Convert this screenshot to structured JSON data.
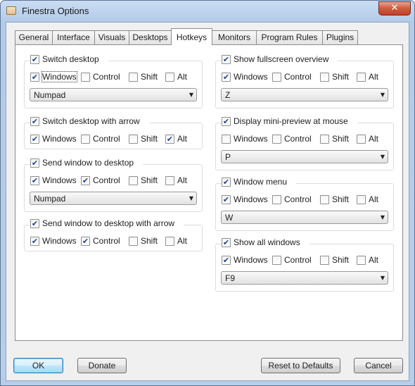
{
  "window": {
    "title": "Finestra Options",
    "close_glyph": "✕"
  },
  "tabs": [
    {
      "label": "General"
    },
    {
      "label": "Interface"
    },
    {
      "label": "Visuals"
    },
    {
      "label": "Desktops"
    },
    {
      "label": "Hotkeys",
      "active": true
    },
    {
      "label": "Monitors"
    },
    {
      "label": "Program Rules"
    },
    {
      "label": "Plugins"
    }
  ],
  "modifier_labels": {
    "windows": "Windows",
    "control": "Control",
    "shift": "Shift",
    "alt": "Alt"
  },
  "check_glyph": "✔",
  "dropdown_arrow": "▼",
  "groups": {
    "switch_desktop": {
      "title": "Switch desktop",
      "enabled": true,
      "windows": true,
      "control": false,
      "shift": false,
      "alt": false,
      "key": "Numpad"
    },
    "switch_desktop_arrow": {
      "title": "Switch desktop with arrow",
      "enabled": true,
      "windows": true,
      "control": false,
      "shift": false,
      "alt": true
    },
    "send_window": {
      "title": "Send window to desktop",
      "enabled": true,
      "windows": true,
      "control": true,
      "shift": false,
      "alt": false,
      "key": "Numpad"
    },
    "send_window_arrow": {
      "title": "Send window to desktop with arrow",
      "enabled": true,
      "windows": true,
      "control": true,
      "shift": false,
      "alt": false
    },
    "fullscreen_overview": {
      "title": "Show fullscreen overview",
      "enabled": true,
      "windows": true,
      "control": false,
      "shift": false,
      "alt": false,
      "key": "Z"
    },
    "mini_preview": {
      "title": "Display mini-preview at mouse",
      "enabled": true,
      "windows": false,
      "control": false,
      "shift": false,
      "alt": false,
      "key": "P"
    },
    "window_menu": {
      "title": "Window menu",
      "enabled": true,
      "windows": true,
      "control": false,
      "shift": false,
      "alt": false,
      "key": "W"
    },
    "show_all_windows": {
      "title": "Show all windows",
      "enabled": true,
      "windows": true,
      "control": false,
      "shift": false,
      "alt": false,
      "key": "F9"
    }
  },
  "buttons": {
    "ok": "OK",
    "donate": "Donate",
    "reset": "Reset to Defaults",
    "cancel": "Cancel"
  }
}
